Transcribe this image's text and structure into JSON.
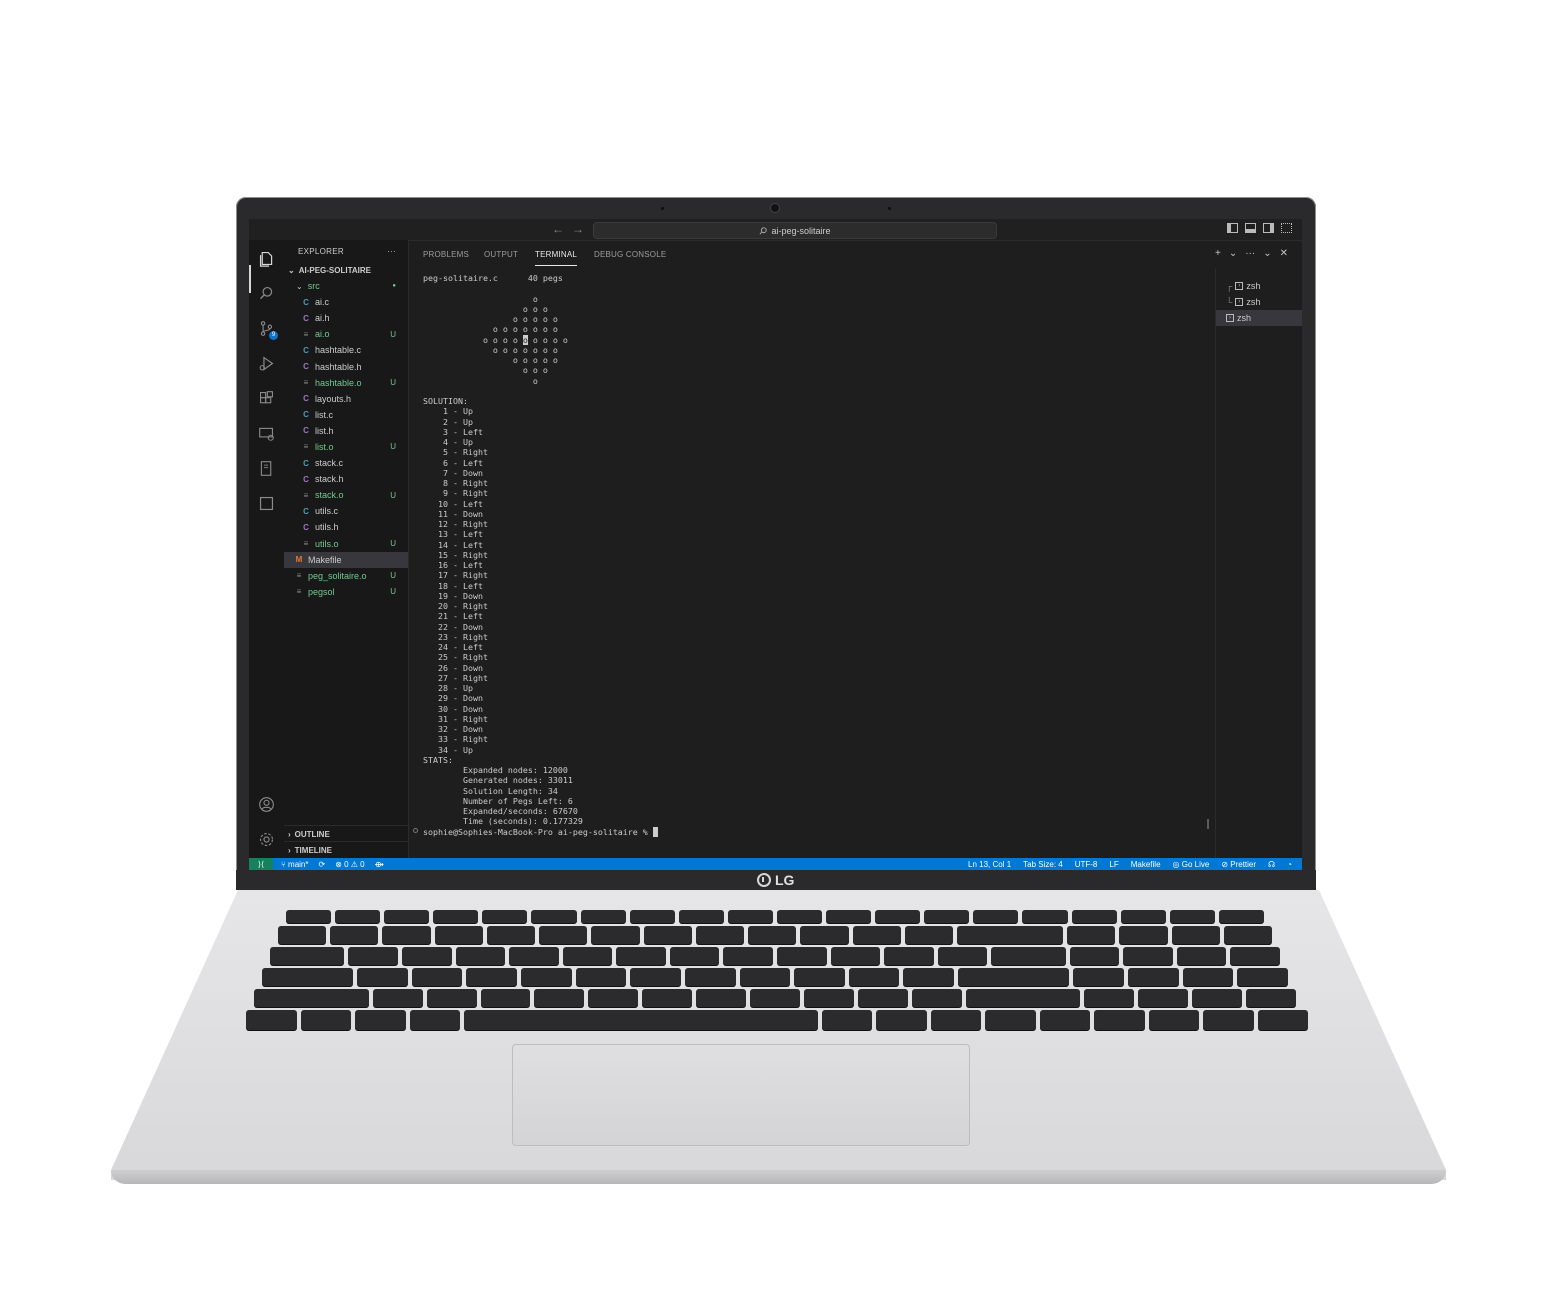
{
  "window": {
    "search_text": "ai-peg-solitaire",
    "nav_back": "←",
    "nav_forward": "→"
  },
  "explorer": {
    "title": "EXPLORER",
    "more": "···",
    "project": "AI-PEG-SOLITAIRE",
    "src_folder": "src",
    "src_status": "●",
    "files": [
      {
        "name": "ai.c",
        "icon": "C",
        "kind": "c",
        "status": ""
      },
      {
        "name": "ai.h",
        "icon": "C",
        "kind": "h",
        "status": ""
      },
      {
        "name": "ai.o",
        "icon": "≡",
        "kind": "o",
        "status": "U"
      },
      {
        "name": "hashtable.c",
        "icon": "C",
        "kind": "c",
        "status": ""
      },
      {
        "name": "hashtable.h",
        "icon": "C",
        "kind": "h",
        "status": ""
      },
      {
        "name": "hashtable.o",
        "icon": "≡",
        "kind": "o",
        "status": "U"
      },
      {
        "name": "layouts.h",
        "icon": "C",
        "kind": "h",
        "status": ""
      },
      {
        "name": "list.c",
        "icon": "C",
        "kind": "c",
        "status": ""
      },
      {
        "name": "list.h",
        "icon": "C",
        "kind": "h",
        "status": ""
      },
      {
        "name": "list.o",
        "icon": "≡",
        "kind": "o",
        "status": "U"
      },
      {
        "name": "stack.c",
        "icon": "C",
        "kind": "c",
        "status": ""
      },
      {
        "name": "stack.h",
        "icon": "C",
        "kind": "h",
        "status": ""
      },
      {
        "name": "stack.o",
        "icon": "≡",
        "kind": "o",
        "status": "U"
      },
      {
        "name": "utils.c",
        "icon": "C",
        "kind": "c",
        "status": ""
      },
      {
        "name": "utils.h",
        "icon": "C",
        "kind": "h",
        "status": ""
      },
      {
        "name": "utils.o",
        "icon": "≡",
        "kind": "o",
        "status": "U"
      }
    ],
    "root_files": [
      {
        "name": "Makefile",
        "icon": "M",
        "kind": "m",
        "status": ""
      },
      {
        "name": "peg_solitaire.o",
        "icon": "≡",
        "kind": "o",
        "status": "U"
      },
      {
        "name": "pegsol",
        "icon": "≡",
        "kind": "o",
        "status": "U"
      }
    ],
    "outline": "OUTLINE",
    "timeline": "TIMELINE"
  },
  "panel": {
    "tabs": [
      "PROBLEMS",
      "OUTPUT",
      "TERMINAL",
      "DEBUG CONSOLE"
    ],
    "active_tab": "TERMINAL",
    "actions": [
      "+",
      "⌄",
      "···",
      "⌄",
      "✕"
    ]
  },
  "terminal": {
    "header_file": "peg-solitaire.c",
    "header_pegs": "40 pegs",
    "board": [
      "                      o",
      "                    o o o",
      "                  o o o o o",
      "              o o o o o o o",
      "            o o o o [o] o o o o",
      "              o o o o o o o",
      "                  o o o o o",
      "                    o o o",
      "                      o"
    ],
    "solution_label": "SOLUTION:",
    "moves": [
      "1 - Up",
      "2 - Up",
      "3 - Left",
      "4 - Up",
      "5 - Right",
      "6 - Left",
      "7 - Down",
      "8 - Right",
      "9 - Right",
      "10 - Left",
      "11 - Down",
      "12 - Right",
      "13 - Left",
      "14 - Left",
      "15 - Right",
      "16 - Left",
      "17 - Right",
      "18 - Left",
      "19 - Down",
      "20 - Right",
      "21 - Left",
      "22 - Down",
      "23 - Right",
      "24 - Left",
      "25 - Right",
      "26 - Down",
      "27 - Right",
      "28 - Up",
      "29 - Down",
      "30 - Down",
      "31 - Right",
      "32 - Down",
      "33 - Right",
      "34 - Up"
    ],
    "stats_label": "STATS:",
    "stats": [
      "Expanded nodes: 12000",
      "Generated nodes: 33011",
      "Solution Length: 34",
      "Number of Pegs Left: 6",
      "Expanded/seconds: 67670",
      "Time (seconds): 0.177329"
    ],
    "prompt": "sophie@Sophies-MacBook-Pro ai-peg-solitaire % "
  },
  "terminal_list": [
    "zsh",
    "zsh",
    "zsh"
  ],
  "statusbar": {
    "remote": "⟩⟨",
    "branch": "main*",
    "sync": "⟳",
    "problems": "⊗ 0 ⚠ 0",
    "run": "⟴",
    "position": "Ln 13, Col 1",
    "tab_size": "Tab Size: 4",
    "encoding": "UTF-8",
    "eol": "LF",
    "language": "Makefile",
    "go_live": "Go Live",
    "prettier": "Prettier"
  },
  "brand": "LG"
}
